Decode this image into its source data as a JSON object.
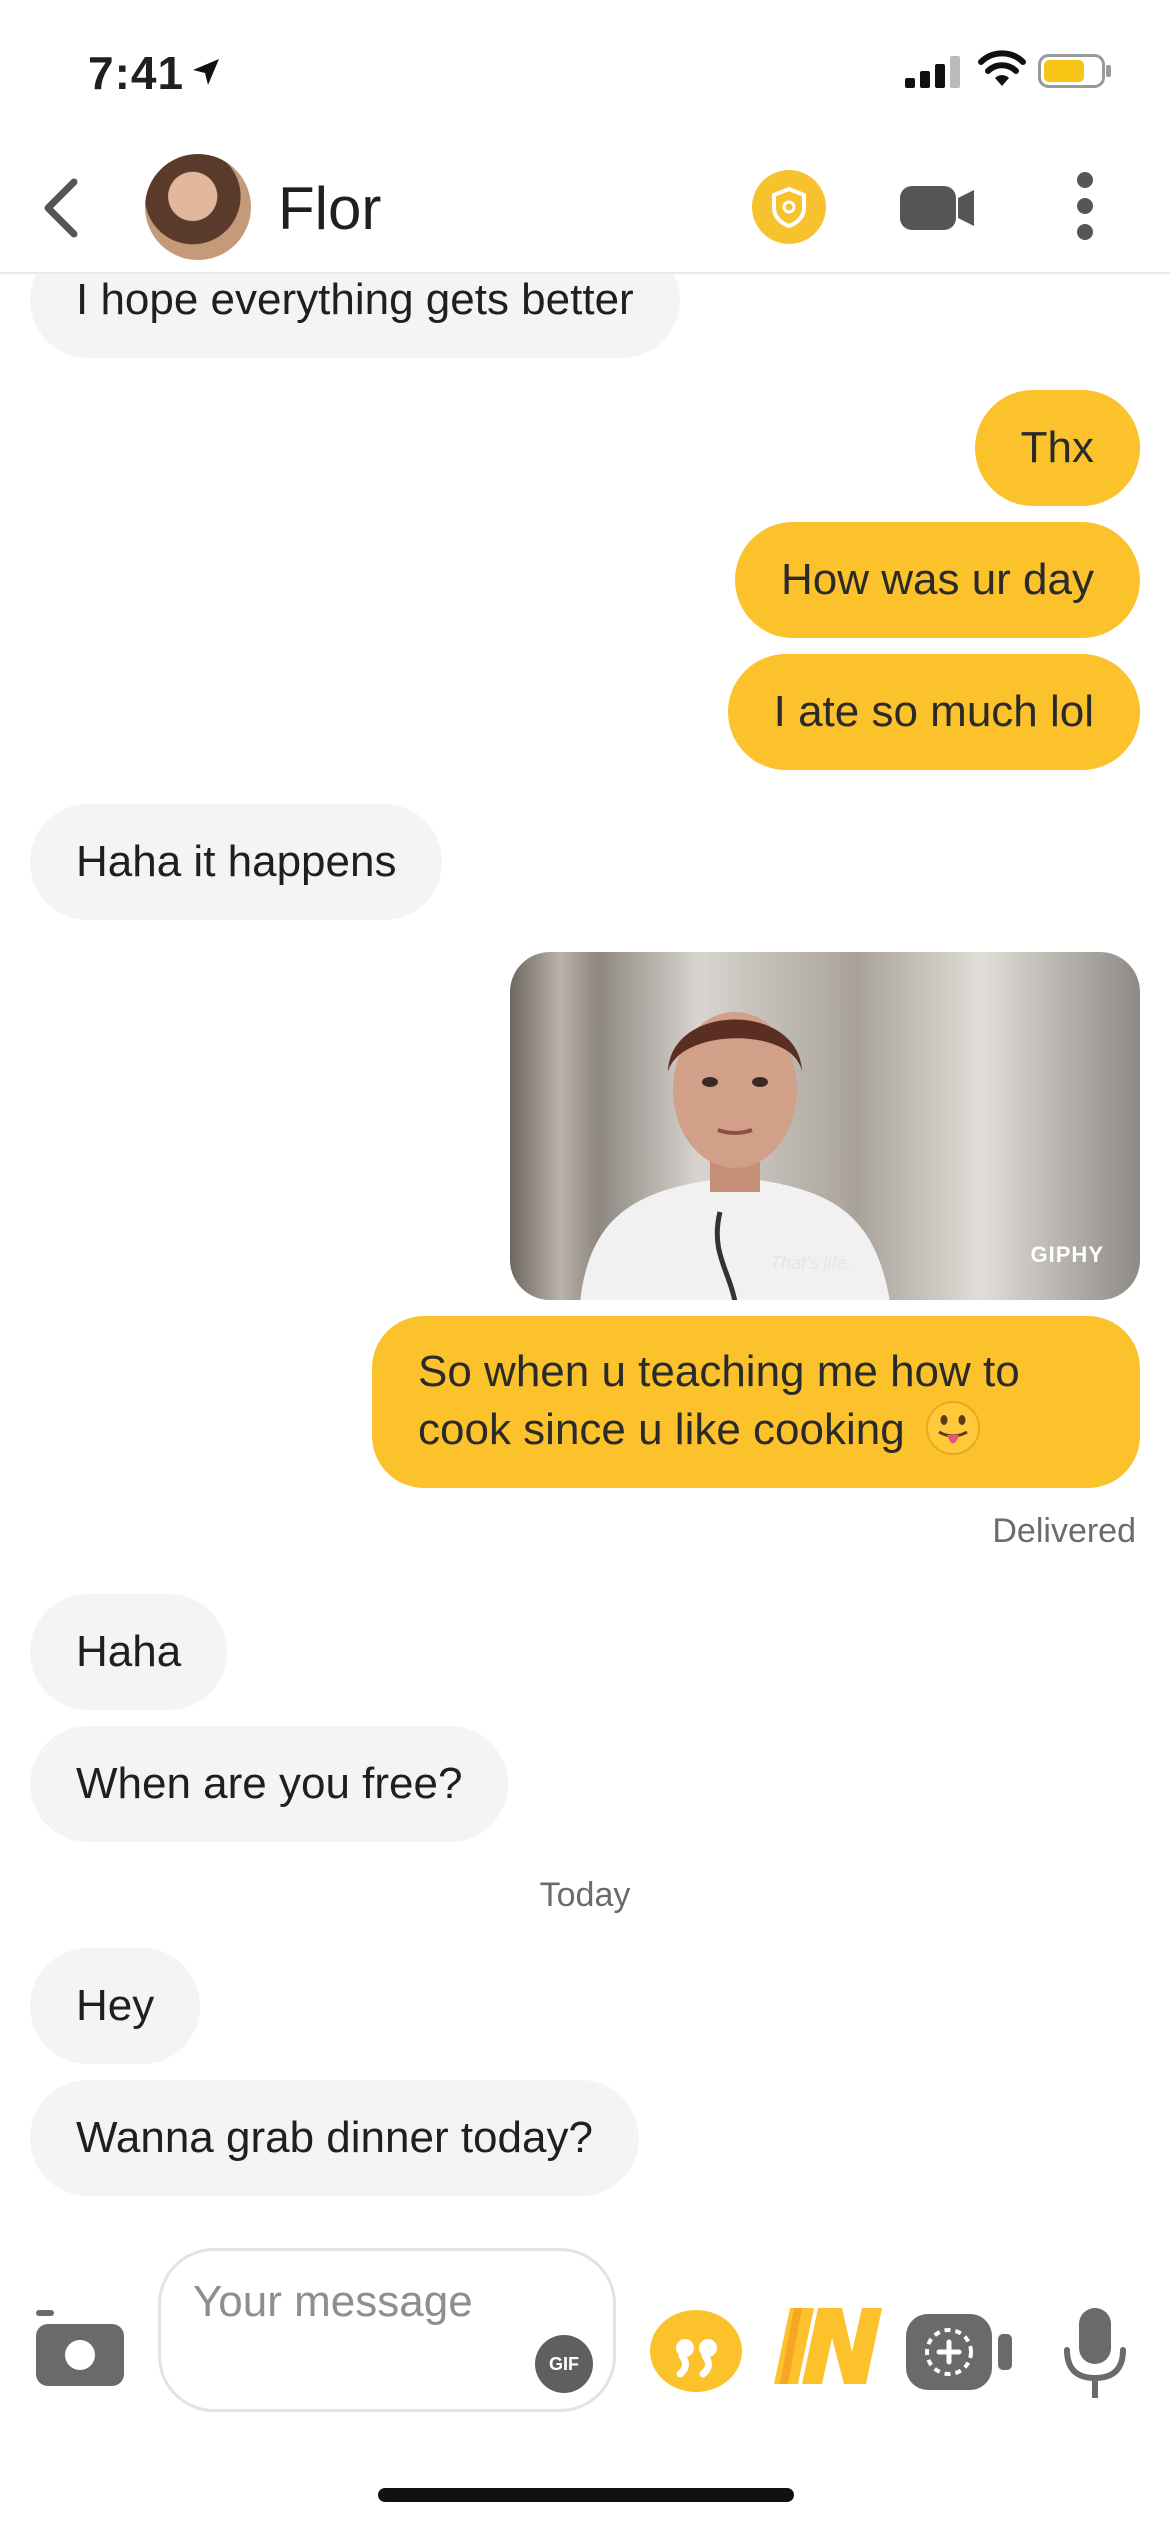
{
  "status_bar": {
    "time": "7:41"
  },
  "header": {
    "contact_name": "Flor"
  },
  "messages": [
    {
      "side": "in",
      "text": "I hope everything gets better"
    },
    {
      "side": "out",
      "text": "Thx"
    },
    {
      "side": "out",
      "text": "How was ur day"
    },
    {
      "side": "out",
      "text": "I ate so much lol"
    },
    {
      "side": "in",
      "text": "Haha it happens"
    },
    {
      "side": "out",
      "type": "gif",
      "caption": "That's life.",
      "source": "GIPHY"
    },
    {
      "side": "out",
      "line1": "So when u teaching me how to",
      "line2": "cook since u like cooking"
    },
    {
      "side": "in",
      "text": "Haha"
    },
    {
      "side": "in",
      "text": "When are you free?"
    },
    {
      "side": "in",
      "text": "Hey"
    },
    {
      "side": "in",
      "text": "Wanna grab dinner today?"
    }
  ],
  "delivered_label": "Delivered",
  "date_separator": "Today",
  "composer": {
    "placeholder": "Your message",
    "gif_label": "GIF"
  },
  "colors": {
    "accent": "#fbc22b",
    "incoming_bubble": "#f4f4f4"
  }
}
